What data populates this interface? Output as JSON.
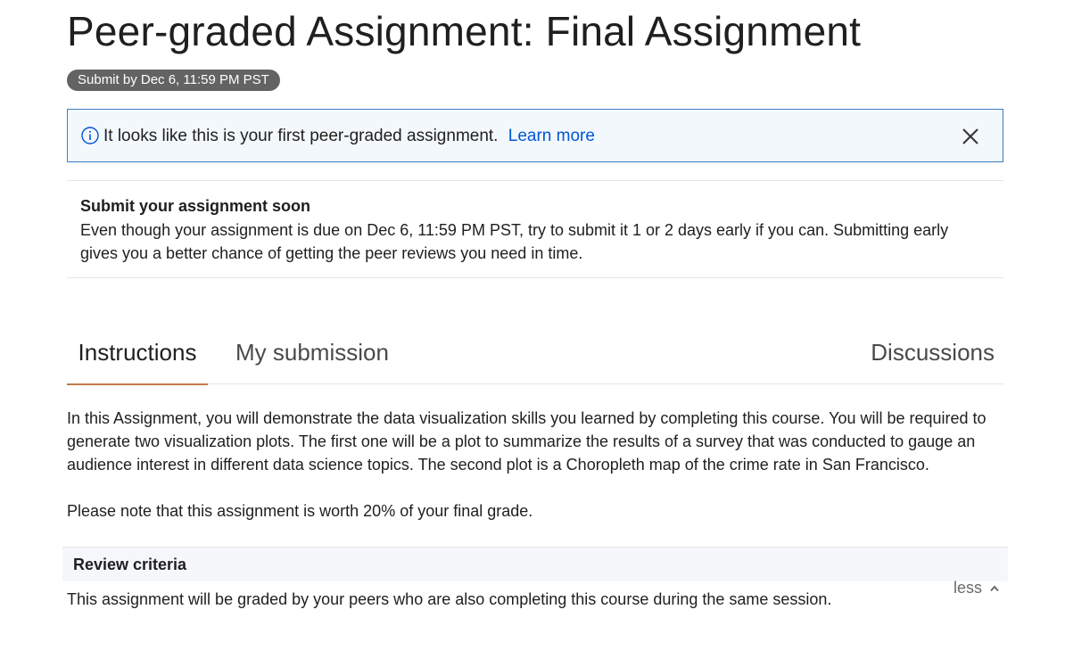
{
  "page": {
    "title": "Peer-graded Assignment: Final Assignment",
    "due_badge": "Submit by Dec 6, 11:59 PM PST"
  },
  "info_banner": {
    "icon": "info-icon",
    "message": "It looks like this is your first peer-graded assignment.",
    "link_label": "Learn more",
    "close_icon": "close-icon"
  },
  "notice": {
    "heading": "Submit your assignment soon",
    "body": "Even though your assignment is due on Dec 6, 11:59 PM PST, try to submit it 1 or 2 days early if you can. Submitting early gives you a better chance of getting the peer reviews you need in time."
  },
  "tabs": [
    {
      "label": "Instructions",
      "active": true
    },
    {
      "label": "My submission",
      "active": false
    },
    {
      "label": "Discussions",
      "active": false
    }
  ],
  "instructions": {
    "paragraph1": "In this Assignment, you will demonstrate the data visualization skills you learned by completing this course. You will be required to generate two visualization plots. The first one will be a plot to summarize the results of a survey that was conducted to gauge an audience interest in different data science topics. The second plot is a Choropleth map of the crime rate in San Francisco.",
    "paragraph2": "Please note that this assignment is worth 20% of your final grade."
  },
  "review": {
    "title": "Review criteria",
    "toggle_label": "less",
    "toggle_icon": "chevron-up-icon",
    "body": "This assignment will be graded by your peers who are also completing this course during the same session."
  },
  "colors": {
    "badge_bg": "#636363",
    "banner_border": "#3c7dc1",
    "link": "#0056d2",
    "active_tab_underline": "#c27b4a"
  }
}
